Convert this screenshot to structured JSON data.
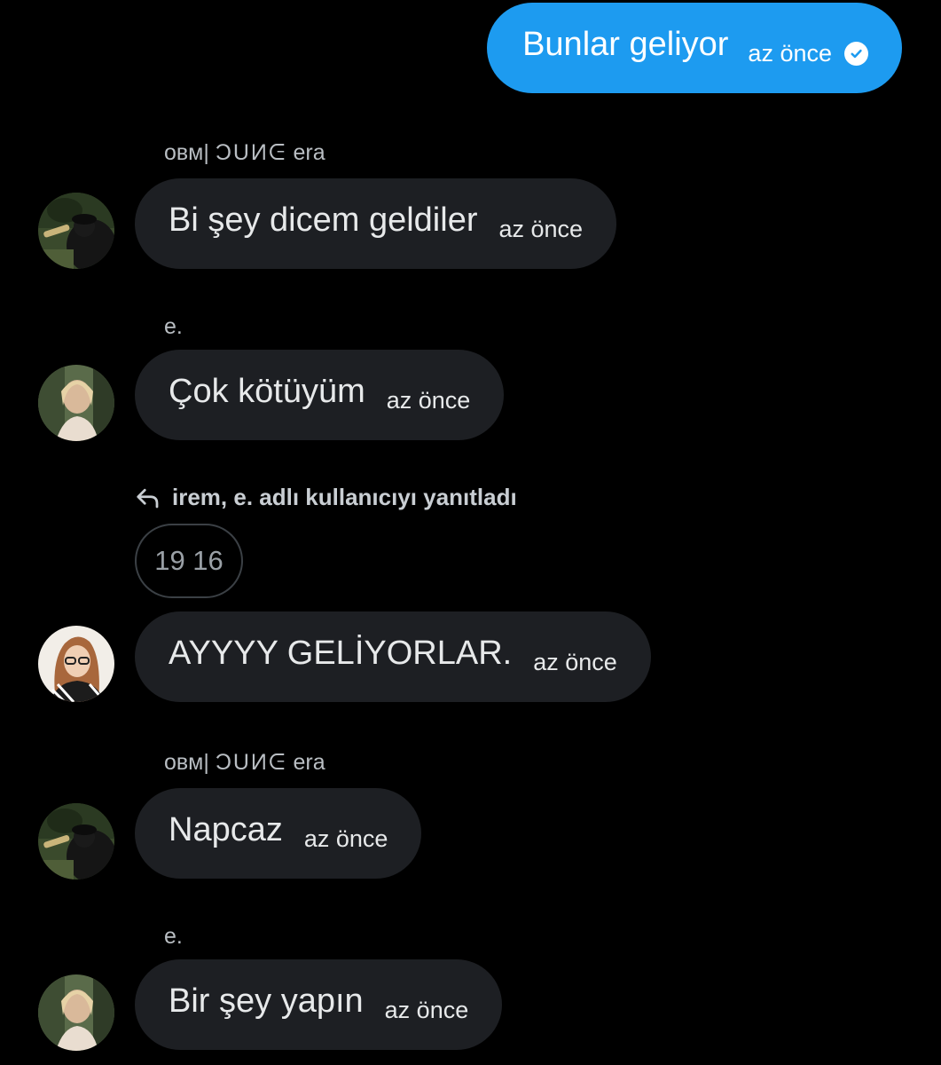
{
  "messages": {
    "m1": {
      "text": "Bunlar geliyor",
      "time": "az önce"
    },
    "m2": {
      "sender_prefix": "ᴏʙᴍ|",
      "sender_dune": "ƆUИᕮ",
      "sender_suffix": "era",
      "text": "Bi şey dicem geldiler",
      "time": "az önce"
    },
    "m3": {
      "sender": "e.",
      "text": "Çok kötüyüm",
      "time": "az önce"
    },
    "m4": {
      "reply_label": "irem, e. adlı kullanıcıyı yanıtladı",
      "quoted": "19 16",
      "text": "AYYYY GELİYORLAR.",
      "time": "az önce"
    },
    "m5": {
      "sender_prefix": "ᴏʙᴍ|",
      "sender_dune": "ƆUИᕮ",
      "sender_suffix": "era",
      "text": "Napcaz",
      "time": "az önce"
    },
    "m6": {
      "sender": "e.",
      "text": "Bir şey yapın",
      "time": "az önce"
    }
  },
  "colors": {
    "outgoing_bubble": "#1d9bf0",
    "incoming_bubble": "#1d1f23",
    "background": "#000000"
  },
  "icons": {
    "read_receipt": "check-circle-icon",
    "reply": "reply-arrow-icon"
  }
}
